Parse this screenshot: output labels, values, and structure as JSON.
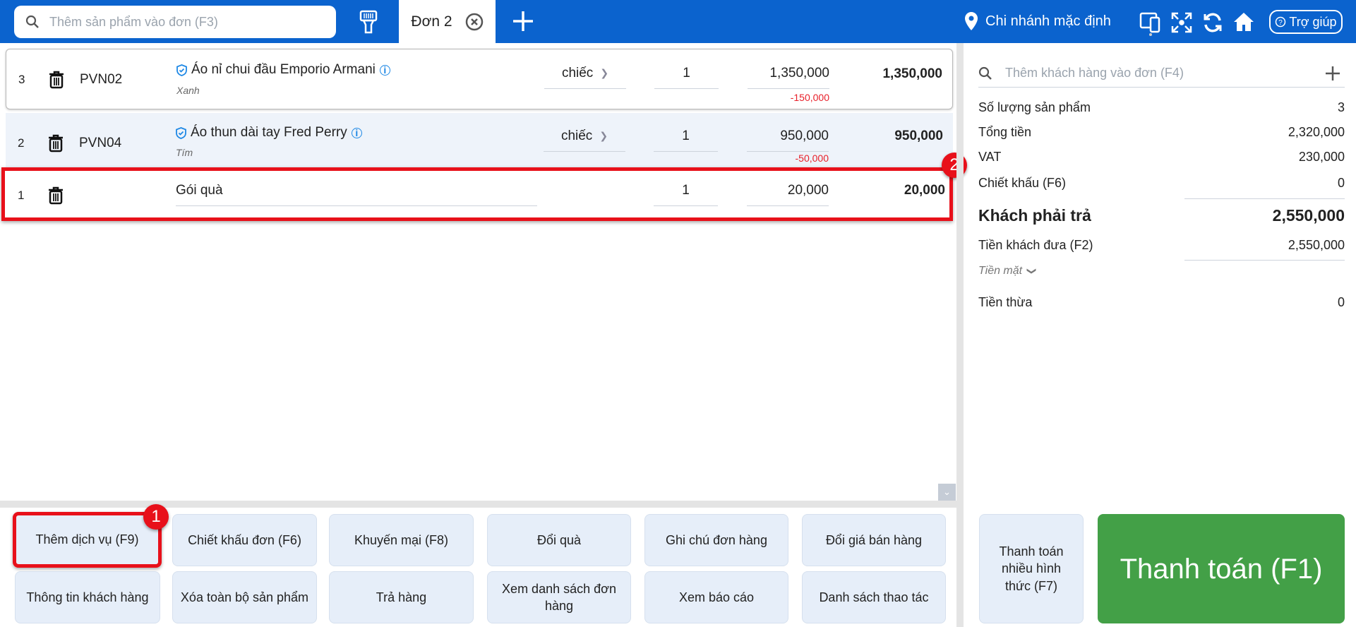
{
  "topbar": {
    "search_placeholder": "Thêm sản phẩm vào đơn (F3)",
    "active_tab": "Đơn 2",
    "branch": "Chi nhánh mặc định",
    "help": "Trợ giúp"
  },
  "items": [
    {
      "index": "3",
      "code": "PVN02",
      "name": "Áo nỉ chui đầu Emporio Armani",
      "variant": "Xanh",
      "unit": "chiếc",
      "qty": "1",
      "price": "1,350,000",
      "discount": "-150,000",
      "total": "1,350,000"
    },
    {
      "index": "2",
      "code": "PVN04",
      "name": "Áo thun dài tay Fred Perry",
      "variant": "Tím",
      "unit": "chiếc",
      "qty": "1",
      "price": "950,000",
      "discount": "-50,000",
      "total": "950,000"
    },
    {
      "index": "1",
      "code": "",
      "name": "Gói quà",
      "qty": "1",
      "price": "20,000",
      "total": "20,000"
    }
  ],
  "actions": [
    "Thêm dịch vụ (F9)",
    "Chiết khấu đơn (F6)",
    "Khuyến mại (F8)",
    "Đổi quà",
    "Ghi chú đơn hàng",
    "Đổi giá bán hàng",
    "Thông tin khách hàng",
    "Xóa toàn bộ sản phẩm",
    "Trả hàng",
    "Xem danh sách đơn hàng",
    "Xem báo cáo",
    "Danh sách thao tác"
  ],
  "summary": {
    "customer_placeholder": "Thêm khách hàng vào đơn (F4)",
    "qty_label": "Số lượng sản phẩm",
    "qty_value": "3",
    "subtotal_label": "Tổng tiền",
    "subtotal_value": "2,320,000",
    "vat_label": "VAT",
    "vat_value": "230,000",
    "discount_label": "Chiết khấu (F6)",
    "discount_value": "0",
    "due_label": "Khách phải trả",
    "due_value": "2,550,000",
    "paid_label": "Tiền khách đưa (F2)",
    "paid_value": "2,550,000",
    "method": "Tiền mặt",
    "change_label": "Tiền thừa",
    "change_value": "0"
  },
  "pay": {
    "multi": "Thanh toán nhiều hình thức (F7)",
    "main": "Thanh toán (F1)"
  },
  "annotations": {
    "one": "1",
    "two": "2"
  },
  "colors": {
    "brand": "#0b63ce",
    "pay": "#43a047",
    "highlight": "#e8101a"
  }
}
